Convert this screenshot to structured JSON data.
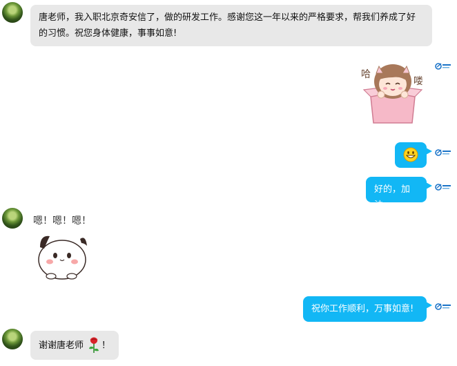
{
  "messages": [
    {
      "from": "left",
      "text": "唐老师，我入职北京奇安信了，做的研发工作。感谢您这一年以来的严格要求，帮我们养成了好的习惯。祝您身体健康，事事如意!"
    },
    {
      "from": "right",
      "sticker": "girl-in-box-sticker",
      "sticker_text": [
        "哈",
        "喽"
      ]
    },
    {
      "from": "right",
      "emoji": "grinning-face-emoji"
    },
    {
      "from": "right",
      "text": "好的，加油"
    },
    {
      "from": "left",
      "sticker": "cat-sticker",
      "sticker_text": "嗯！嗯！嗯！"
    },
    {
      "from": "right",
      "text": "祝你工作顺利，万事如意!"
    },
    {
      "from": "left",
      "text_prefix": "谢谢唐老师",
      "emoji": "rose-emoji",
      "text_suffix": "！"
    }
  ],
  "colors": {
    "incoming_bubble": "#e8e8e8",
    "outgoing_bubble": "#12b7f5",
    "outgoing_text": "#ffffff"
  },
  "icons": {
    "avatar": "avatar-forest",
    "status_badge": "svip-badge-icon"
  }
}
